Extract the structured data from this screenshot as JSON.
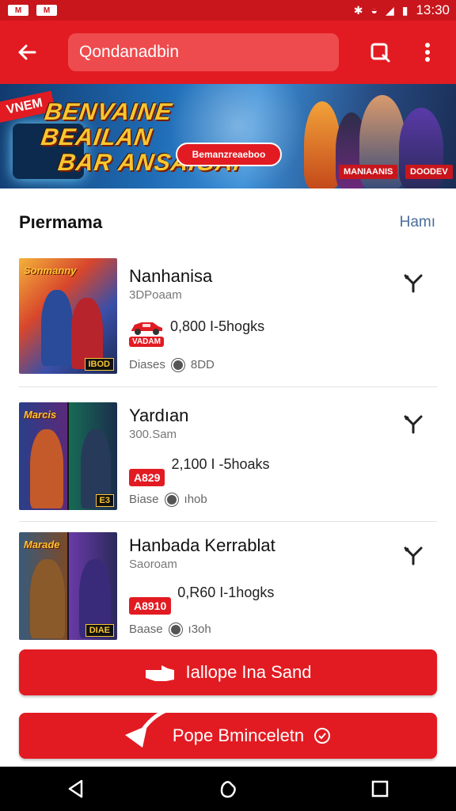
{
  "status_bar": {
    "time": "13:30",
    "left_icons": [
      "M",
      "M"
    ],
    "right_icons": [
      "bluetooth-icon",
      "wifi-icon",
      "signal-icon",
      "battery-icon"
    ]
  },
  "app_bar": {
    "search_value": "Qondanadbin",
    "icons": [
      "back-arrow-icon",
      "search-icon",
      "more-vert-icon"
    ]
  },
  "banner": {
    "tag": "VNEM",
    "headline_line1": "BENVAINE BEAILAN",
    "headline_line2": "BAR ANSAIGAI",
    "pill": "Bemanzreaeboo",
    "chip_left": "MANIAANIS",
    "chip_right": "DOODEV"
  },
  "section": {
    "title": "Pıermama",
    "link": "Hamı"
  },
  "items": [
    {
      "title": "Nanhanisa",
      "subtitle": "3DPoaam",
      "price_badge": "VADAM",
      "price": "0,800 I-5hogks",
      "meta_left": "Diases",
      "meta_right": "8DD",
      "thumb_title": "Sonmanny",
      "thumb_badge": "IBOD"
    },
    {
      "title": "Yardıan",
      "subtitle": "300.Sam",
      "price_badge": "A829",
      "price": "2,100 I -5hoaks",
      "meta_left": "Biase",
      "meta_right": "ıhob",
      "thumb_title": "Marcis",
      "thumb_badge": "E3"
    },
    {
      "title": "Hanbada Kerrablat",
      "subtitle": "Saoroam",
      "price_badge": "A8910",
      "price": "0,R60 I-1hogks",
      "meta_left": "Baase",
      "meta_right": "ı3oh",
      "thumb_title": "Marade",
      "thumb_badge": "DIAE"
    }
  ],
  "buttons": {
    "primary": "Iallope Ina Sand",
    "secondary": "Pope Bminceletn"
  },
  "colors": {
    "brand_red": "#e21b22",
    "status_red": "#c8161c"
  }
}
